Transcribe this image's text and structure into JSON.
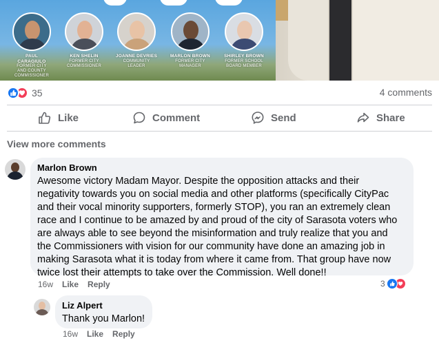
{
  "banner": {
    "people": [
      {
        "name": "PAUL\nCARAGIULO",
        "role": "FORMER CITY\nAND COUNTY\nCOMMISSIONER",
        "skin": "#c8946f",
        "shirt": "#2f3b4c",
        "bg": "#3c6c8a"
      },
      {
        "name": "KEN SHELIN",
        "role": "FORMER CITY\nCOMMISSIONER",
        "skin": "#e2b294",
        "shirt": "#4a4f5a",
        "bg": "#cfd3d8"
      },
      {
        "name": "JOANNE DEVRIES",
        "role": "COMMUNITY\nLEADER",
        "skin": "#e8c3a6",
        "shirt": "#caa27a",
        "bg": "#d6d2cc"
      },
      {
        "name": "MARLON BROWN",
        "role": "FORMER CITY\nMANAGER",
        "skin": "#6a4a36",
        "shirt": "#1e2531",
        "bg": "#9fb4c7"
      },
      {
        "name": "SHIRLEY BROWN",
        "role": "FORMER SCHOOL\nBOARD MEMBER",
        "skin": "#e9c7b0",
        "shirt": "#3c4b73",
        "bg": "#d9dde3"
      }
    ]
  },
  "reactions": {
    "count": "35"
  },
  "comments_count": "4 comments",
  "actions": {
    "like": "Like",
    "comment": "Comment",
    "send": "Send",
    "share": "Share"
  },
  "view_more": "View more comments",
  "comments": [
    {
      "author": "Marlon Brown",
      "text": "Awesome victory Madam Mayor. Despite the opposition attacks and their\nnegativity towards you on social media and other platforms (specifically CityPac\nand their vocal minority supporters, formerly STOP), you ran an extremely clean\nrace and I continue to be amazed by and proud of the city of Sarasota voters who\nare always able to see beyond the misinformation and truly realize that you and\nthe Commissioners with vision for our community have done an amazing job in\nmaking Sarasota what it is today from where it came from. That group have now\ntwice lost their attempts to take over the Commission. Well done!!",
      "time": "16w",
      "like": "Like",
      "reply": "Reply",
      "reaction_count": "3",
      "avatar_skin": "#5a3d2c",
      "avatar_shirt": "#1c2330"
    },
    {
      "author": "Liz Alpert",
      "text": "Thank you Marlon!",
      "time": "16w",
      "like": "Like",
      "reply": "Reply",
      "avatar_skin": "#e4bea3",
      "avatar_shirt": "#6b5b55"
    }
  ],
  "colors": {
    "like_blue": "#1877f2",
    "love_red": "#f33e58",
    "secondary_text": "#65676b",
    "bubble": "#f0f2f5"
  }
}
